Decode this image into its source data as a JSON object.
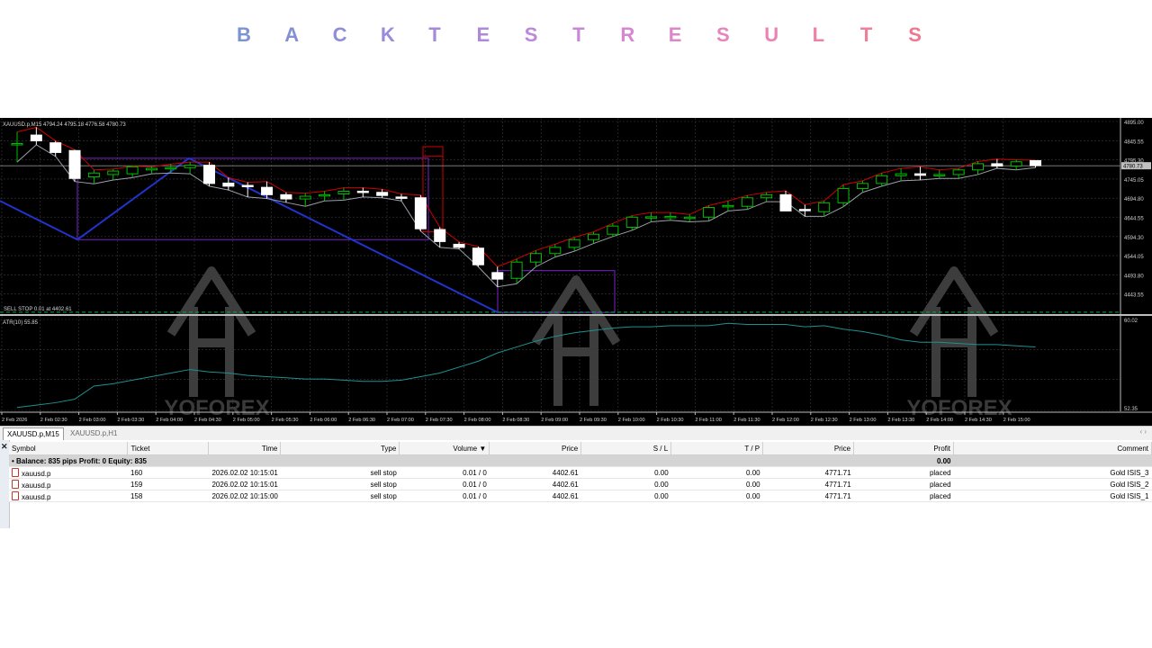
{
  "title": {
    "letters": [
      "B",
      "A",
      "C",
      "K",
      "T",
      "E",
      "S",
      "T",
      "R",
      "E",
      "S",
      "U",
      "L",
      "T",
      "S"
    ],
    "colors": [
      "#7b93d2",
      "#8390d3",
      "#8e8fd6",
      "#9a8cd8",
      "#a48ad8",
      "#ae89d9",
      "#bb88da",
      "#c988d6",
      "#d588cf",
      "#de87c6",
      "#e585bd",
      "#ea84b3",
      "#ed82a7",
      "#ef7e9b",
      "#f0778d"
    ]
  },
  "chart": {
    "info_label": "XAUUSD.p,M15  4794.24 4795.18 4776.58 4780.73",
    "order_line_label": "SELL STOP 0.01 at 4402.61",
    "atr_label": "ATR(10) 55.85",
    "watermark_text": "YOFOREX",
    "price_labels": [
      "4895.00",
      "4845.55",
      "4795.30",
      "4745.05",
      "4694.80",
      "4644.55",
      "4594.30",
      "4544.05",
      "4493.80",
      "4443.55"
    ],
    "current_price": "4780.73",
    "atr_labels": [
      "60.02",
      "52.35"
    ],
    "time_labels": [
      "2 Feb 2026",
      "2 Feb 02:30",
      "2 Feb 03:00",
      "2 Feb 03:30",
      "2 Feb 04:00",
      "2 Feb 04:30",
      "2 Feb 05:00",
      "2 Feb 05:30",
      "2 Feb 06:00",
      "2 Feb 06:30",
      "2 Feb 07:00",
      "2 Feb 07:30",
      "2 Feb 08:00",
      "2 Feb 08:30",
      "2 Feb 09:00",
      "2 Feb 09:30",
      "2 Feb 10:00",
      "2 Feb 10:30",
      "2 Feb 11:00",
      "2 Feb 11:30",
      "2 Feb 12:00",
      "2 Feb 12:30",
      "2 Feb 13:00",
      "2 Feb 13:30",
      "2 Feb 14:00",
      "2 Feb 14:30",
      "2 Feb 15:00"
    ],
    "colors": {
      "bg": "#000000",
      "grid": "#3a3a3a",
      "bull": "#00c000",
      "bear": "#ffffff",
      "red_line": "#d00000",
      "gray_line": "#9aa0a8",
      "blue": "#2233cc",
      "purple": "#7a22cc",
      "atr": "#1f9090",
      "order_line": "#00aa44"
    },
    "candles": [
      {
        "o": 4838,
        "h": 4868,
        "l": 4790,
        "c": 4838
      },
      {
        "o": 4860,
        "h": 4880,
        "l": 4835,
        "c": 4845
      },
      {
        "o": 4840,
        "h": 4845,
        "l": 4805,
        "c": 4815
      },
      {
        "o": 4820,
        "h": 4822,
        "l": 4740,
        "c": 4748
      },
      {
        "o": 4752,
        "h": 4770,
        "l": 4734,
        "c": 4762
      },
      {
        "o": 4758,
        "h": 4772,
        "l": 4744,
        "c": 4767
      },
      {
        "o": 4760,
        "h": 4780,
        "l": 4750,
        "c": 4778
      },
      {
        "o": 4770,
        "h": 4778,
        "l": 4760,
        "c": 4774
      },
      {
        "o": 4774,
        "h": 4785,
        "l": 4762,
        "c": 4776
      },
      {
        "o": 4776,
        "h": 4790,
        "l": 4760,
        "c": 4782
      },
      {
        "o": 4782,
        "h": 4790,
        "l": 4728,
        "c": 4735
      },
      {
        "o": 4736,
        "h": 4750,
        "l": 4718,
        "c": 4728
      },
      {
        "o": 4730,
        "h": 4738,
        "l": 4700,
        "c": 4728
      },
      {
        "o": 4725,
        "h": 4740,
        "l": 4696,
        "c": 4706
      },
      {
        "o": 4706,
        "h": 4712,
        "l": 4686,
        "c": 4695
      },
      {
        "o": 4695,
        "h": 4710,
        "l": 4676,
        "c": 4702
      },
      {
        "o": 4704,
        "h": 4715,
        "l": 4690,
        "c": 4706
      },
      {
        "o": 4708,
        "h": 4724,
        "l": 4692,
        "c": 4715
      },
      {
        "o": 4715,
        "h": 4724,
        "l": 4700,
        "c": 4712
      },
      {
        "o": 4712,
        "h": 4720,
        "l": 4698,
        "c": 4704
      },
      {
        "o": 4700,
        "h": 4708,
        "l": 4690,
        "c": 4698
      },
      {
        "o": 4698,
        "h": 4705,
        "l": 4612,
        "c": 4618
      },
      {
        "o": 4616,
        "h": 4622,
        "l": 4570,
        "c": 4585
      },
      {
        "o": 4578,
        "h": 4584,
        "l": 4566,
        "c": 4570
      },
      {
        "o": 4568,
        "h": 4572,
        "l": 4520,
        "c": 4525
      },
      {
        "o": 4505,
        "h": 4520,
        "l": 4468,
        "c": 4488
      },
      {
        "o": 4490,
        "h": 4540,
        "l": 4476,
        "c": 4532
      },
      {
        "o": 4532,
        "h": 4562,
        "l": 4520,
        "c": 4554
      },
      {
        "o": 4554,
        "h": 4578,
        "l": 4545,
        "c": 4570
      },
      {
        "o": 4570,
        "h": 4596,
        "l": 4560,
        "c": 4590
      },
      {
        "o": 4590,
        "h": 4610,
        "l": 4580,
        "c": 4604
      },
      {
        "o": 4604,
        "h": 4632,
        "l": 4598,
        "c": 4625
      },
      {
        "o": 4622,
        "h": 4652,
        "l": 4614,
        "c": 4648
      },
      {
        "o": 4646,
        "h": 4660,
        "l": 4636,
        "c": 4649
      },
      {
        "o": 4649,
        "h": 4660,
        "l": 4640,
        "c": 4650
      },
      {
        "o": 4648,
        "h": 4655,
        "l": 4636,
        "c": 4648
      },
      {
        "o": 4648,
        "h": 4678,
        "l": 4638,
        "c": 4673
      },
      {
        "o": 4676,
        "h": 4690,
        "l": 4664,
        "c": 4678
      },
      {
        "o": 4676,
        "h": 4704,
        "l": 4668,
        "c": 4698
      },
      {
        "o": 4698,
        "h": 4712,
        "l": 4688,
        "c": 4706
      },
      {
        "o": 4706,
        "h": 4716,
        "l": 4688,
        "c": 4664
      },
      {
        "o": 4668,
        "h": 4680,
        "l": 4650,
        "c": 4665
      },
      {
        "o": 4662,
        "h": 4690,
        "l": 4650,
        "c": 4685
      },
      {
        "o": 4685,
        "h": 4732,
        "l": 4675,
        "c": 4722
      },
      {
        "o": 4722,
        "h": 4742,
        "l": 4712,
        "c": 4735
      },
      {
        "o": 4735,
        "h": 4762,
        "l": 4728,
        "c": 4755
      },
      {
        "o": 4755,
        "h": 4774,
        "l": 4742,
        "c": 4760
      },
      {
        "o": 4760,
        "h": 4778,
        "l": 4744,
        "c": 4756
      },
      {
        "o": 4756,
        "h": 4770,
        "l": 4748,
        "c": 4758
      },
      {
        "o": 4758,
        "h": 4774,
        "l": 4748,
        "c": 4770
      },
      {
        "o": 4770,
        "h": 4792,
        "l": 4758,
        "c": 4786
      },
      {
        "o": 4786,
        "h": 4798,
        "l": 4774,
        "c": 4780
      },
      {
        "o": 4780,
        "h": 4796,
        "l": 4770,
        "c": 4791
      },
      {
        "o": 4794,
        "h": 4795,
        "l": 4776,
        "c": 4781
      }
    ],
    "atr_values": [
      52.6,
      52.8,
      53.0,
      53.3,
      54.4,
      54.6,
      54.9,
      55.2,
      55.5,
      55.8,
      55.6,
      55.5,
      55.3,
      55.2,
      55.1,
      55.0,
      55.0,
      54.9,
      54.8,
      54.8,
      54.9,
      55.2,
      55.5,
      56.0,
      56.5,
      57.2,
      57.7,
      58.2,
      58.6,
      58.9,
      59.1,
      59.3,
      59.4,
      59.4,
      59.5,
      59.5,
      59.5,
      59.7,
      59.6,
      59.6,
      59.6,
      59.4,
      59.5,
      59.2,
      59.0,
      58.7,
      58.3,
      58.1,
      58.1,
      58.0,
      57.9,
      57.9,
      57.8,
      57.7
    ],
    "sell_stop_price": 4402.61
  },
  "tabs": [
    {
      "label": "XAUUSD.p,M15",
      "active": true
    },
    {
      "label": "XAUUSD.p,H1",
      "active": false
    }
  ],
  "table": {
    "headers": {
      "symbol": "Symbol",
      "ticket": "Ticket",
      "time": "Time",
      "type": "Type",
      "volume": "Volume",
      "price": "Price",
      "sl": "S / L",
      "tp": "T / P",
      "price2": "Price",
      "profit": "Profit",
      "comment": "Comment"
    },
    "balance_row": {
      "label": "Balance: 835 pips   Profit: 0   Equity: 835",
      "profit": "0.00"
    },
    "rows": [
      {
        "symbol": "xauusd.p",
        "ticket": "160",
        "time": "2026.02.02 10:15:01",
        "type": "sell stop",
        "volume": "0.01 / 0",
        "price": "4402.61",
        "sl": "0.00",
        "tp": "0.00",
        "price2": "4771.71",
        "profit": "placed",
        "comment": "Gold ISIS_3"
      },
      {
        "symbol": "xauusd.p",
        "ticket": "159",
        "time": "2026.02.02 10:15:01",
        "type": "sell stop",
        "volume": "0.01 / 0",
        "price": "4402.61",
        "sl": "0.00",
        "tp": "0.00",
        "price2": "4771.71",
        "profit": "placed",
        "comment": "Gold ISIS_2"
      },
      {
        "symbol": "xauusd.p",
        "ticket": "158",
        "time": "2026.02.02 10:15:00",
        "type": "sell stop",
        "volume": "0.01 / 0",
        "price": "4402.61",
        "sl": "0.00",
        "tp": "0.00",
        "price2": "4771.71",
        "profit": "placed",
        "comment": "Gold ISIS_1"
      }
    ]
  }
}
